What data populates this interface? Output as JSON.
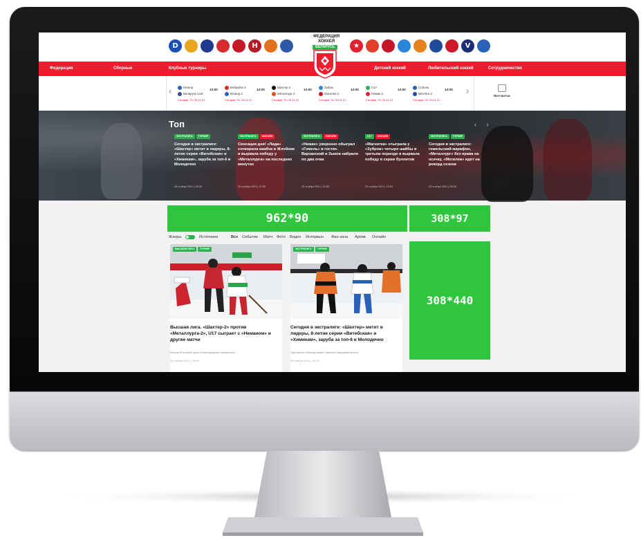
{
  "header": {
    "federation_title": "ФЕДЕРАЦИЯ ХОККЕЯ",
    "federation_badge": "БЕЛАРУСЬ",
    "left_clubs": [
      {
        "letter": "D",
        "color": "#1a4fb8"
      },
      {
        "letter": "",
        "color": "#e8a51d"
      },
      {
        "letter": "",
        "color": "#1f3a8f"
      },
      {
        "letter": "",
        "color": "#d72a2a"
      },
      {
        "letter": "",
        "color": "#c7182a"
      },
      {
        "letter": "H",
        "color": "#b51b25"
      },
      {
        "letter": "",
        "color": "#e3701c"
      },
      {
        "letter": "",
        "color": "#2d57a8"
      }
    ],
    "right_clubs": [
      {
        "letter": "★",
        "color": "#e3202f"
      },
      {
        "letter": "",
        "color": "#e2402a"
      },
      {
        "letter": "",
        "color": "#c5162c"
      },
      {
        "letter": "",
        "color": "#2a86d9"
      },
      {
        "letter": "",
        "color": "#e7821e"
      },
      {
        "letter": "",
        "color": "#204a9a"
      },
      {
        "letter": "",
        "color": "#cc1a2a"
      },
      {
        "letter": "V",
        "color": "#1b2f78"
      },
      {
        "letter": "",
        "color": "#2a62b7"
      }
    ]
  },
  "nav": {
    "items": [
      "Федерация",
      "Сборные",
      "Клубные турниры",
      "Детский хоккей",
      "Любительский хоккей",
      "Сотрудничество"
    ]
  },
  "games": {
    "items": [
      {
        "team1": "Юниор",
        "team2": "Беларусь U18",
        "time": "13:00",
        "date": "Сегодня, Пт, 26.11.21",
        "c1": "#2a62b7",
        "c2": "#3b4a8e"
      },
      {
        "team1": "Бобруйск 2",
        "team2": "Юниор 2",
        "time": "13:00",
        "date": "Сегодня, Пт, 26.11.21",
        "c1": "#d72a2a",
        "c2": "#2a62b7"
      },
      {
        "team1": "Шахтер 2",
        "team2": "Металлург 2",
        "time": "13:00",
        "date": "Сегодня, Пт, 26.11.21",
        "c1": "#111111",
        "c2": "#d7532a"
      },
      {
        "team1": "Зубры",
        "team2": "Могилев 2",
        "time": "13:00",
        "date": "Сегодня, Пт, 26.11.21",
        "c1": "#2a86d9",
        "c2": "#c5162c"
      },
      {
        "team1": "U17",
        "team2": "Неман 2",
        "time": "13:00",
        "date": "Сегодня, Пт, 26.11.21",
        "c1": "#2bb24c",
        "c2": "#e3202f"
      },
      {
        "team1": "Соболь",
        "team2": "Витебск 2",
        "time": "13:00",
        "date": "Сегодня, Пт, 26.11.21",
        "c1": "#2a62b7",
        "c2": "#204a9a"
      }
    ],
    "all_matches_label": "Все матчи"
  },
  "top": {
    "title": "Топ",
    "nav_arrows": "‹ ›",
    "cards": [
      {
        "tag1": "ЭКСТРАЛИГА",
        "tag2": "ТУРНИР",
        "headline": "Сегодня в экстралиге: «Шахтер» метит в лидеры, 8-летие серии «Витебская» и «Химикам», заруба за топ-6 в Молодечно",
        "meta": "26 ноября 2021 | 08:00"
      },
      {
        "tag1": "ЭКСТРАЛИГА",
        "tag2": "ОНЛАЙН",
        "headline": "Сенсация дня! «Лида» сотворила камбэк в Жлобине и вырвала победу у «Металлурга» на последних минутах",
        "meta": "26 ноября 2021 | 22:58"
      },
      {
        "tag1": "ЭКСТРАЛИГА",
        "tag2": "ОНЛАЙН",
        "headline": "«Неман» уверенно обыграл «Гомель» в гостях. Варзанский и Зыков набрали по два очка",
        "meta": "25 ноября 2021 | 20:53"
      },
      {
        "tag1": "U17",
        "tag2": "ОНЛАЙН",
        "headline": "«Магнитка» отыграла у «Зубров» четыре шайбы в третьем периоде и вырвала победу в серии буллитов",
        "meta": "25 ноября 2021 | 19:53"
      },
      {
        "tag1": "ЭКСТРАЛИГА",
        "tag2": "ТУРНИР",
        "headline": "Сегодня в экстралиге: гомельский марафон, «Металлург» без права на осечку, «Могилев» идет на рекорд сезона",
        "meta": "25 ноября 2021 | 08:00"
      }
    ]
  },
  "ads": {
    "banner_wide": "962*90",
    "banner_small": "308*97",
    "banner_tall": "308*440"
  },
  "filters": {
    "genres_label": "Жанры",
    "sources_label": "Источники",
    "items": [
      "Все",
      "Событие",
      "Матч",
      "Фото",
      "Видео",
      "Интервью",
      "Фан-зона",
      "Архив",
      "Онлайн"
    ]
  },
  "news": [
    {
      "tag1": "ВЫСШАЯ ЛИГА",
      "tag2": "ТУРНИР",
      "title": "Высшая лига. «Шахтер-2» против «Металлурга-2», U17 сыграет с «Неманом» и другие матчи",
      "desc": "Большой игровой день в молодежном чемпионате",
      "meta": "26 ноября 2021 | 09:15"
    },
    {
      "tag1": "ЭКСТРАЛИГА",
      "tag2": "ТУРНИР",
      "title": "Сегодня в экстралиге: «Шахтер» метит в лидеры, 8-летие серии «Витебская» и «Химикам», заруба за топ-6 в Молодечно",
      "desc": "Турнирная таблица может серьезно видоизмениться",
      "meta": "26 ноября 2021 | 08:00"
    }
  ],
  "colors": {
    "brand_red": "#ee1d2d",
    "brand_green": "#2bb24c",
    "ad_green": "#2fc63d"
  }
}
